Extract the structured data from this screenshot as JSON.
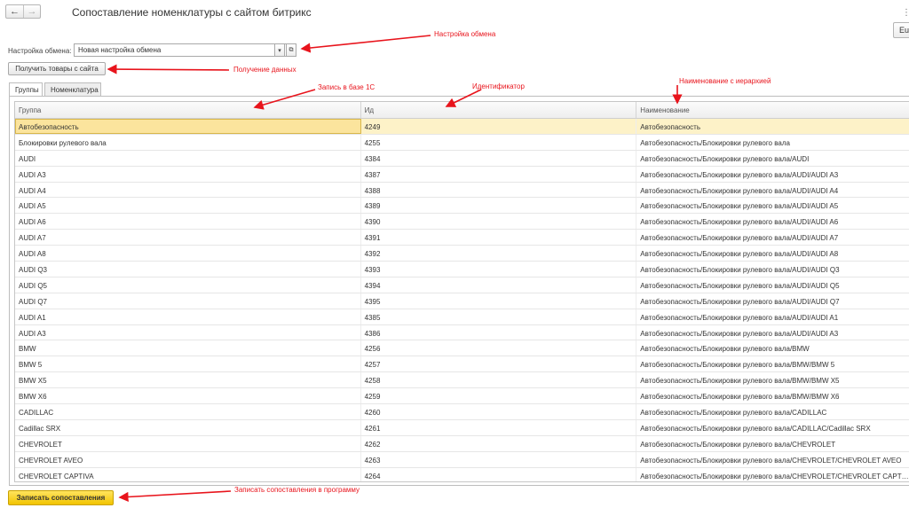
{
  "titlebar": {
    "back_icon": "arrow-left-icon",
    "forward_icon": "arrow-right-icon",
    "title": "Сопоставление номенклатуры с сайтом битрикс",
    "corner_button": "Eu",
    "more_icon": "vertical-dots-icon"
  },
  "settings": {
    "label": "Настройка обмена:",
    "value": "Новая настройка обмена",
    "dropdown_icon": "dropdown-arrow-icon",
    "open_icon": "open-form-icon"
  },
  "fetch_button": "Получить товары с сайта",
  "tabs": [
    {
      "label": "Группы",
      "active": true
    },
    {
      "label": "Номенклатура",
      "active": false
    }
  ],
  "table": {
    "columns": [
      "Группа",
      "Ид",
      "Наименование"
    ],
    "rows": [
      [
        "Автобезопасность",
        "4249",
        "Автобезопасность"
      ],
      [
        "Блокировки рулевого вала",
        "4255",
        "Автобезопасность/Блокировки рулевого вала"
      ],
      [
        "AUDI",
        "4384",
        "Автобезопасность/Блокировки рулевого вала/AUDI"
      ],
      [
        "AUDI A3",
        "4387",
        "Автобезопасность/Блокировки рулевого вала/AUDI/AUDI A3"
      ],
      [
        "AUDI A4",
        "4388",
        "Автобезопасность/Блокировки рулевого вала/AUDI/AUDI A4"
      ],
      [
        "AUDI A5",
        "4389",
        "Автобезопасность/Блокировки рулевого вала/AUDI/AUDI A5"
      ],
      [
        "AUDI A6",
        "4390",
        "Автобезопасность/Блокировки рулевого вала/AUDI/AUDI A6"
      ],
      [
        "AUDI A7",
        "4391",
        "Автобезопасность/Блокировки рулевого вала/AUDI/AUDI A7"
      ],
      [
        "AUDI A8",
        "4392",
        "Автобезопасность/Блокировки рулевого вала/AUDI/AUDI A8"
      ],
      [
        "AUDI Q3",
        "4393",
        "Автобезопасность/Блокировки рулевого вала/AUDI/AUDI Q3"
      ],
      [
        "AUDI Q5",
        "4394",
        "Автобезопасность/Блокировки рулевого вала/AUDI/AUDI Q5"
      ],
      [
        "AUDI Q7",
        "4395",
        "Автобезопасность/Блокировки рулевого вала/AUDI/AUDI Q7"
      ],
      [
        "AUDI A1",
        "4385",
        "Автобезопасность/Блокировки рулевого вала/AUDI/AUDI A1"
      ],
      [
        "AUDI A3",
        "4386",
        "Автобезопасность/Блокировки рулевого вала/AUDI/AUDI A3"
      ],
      [
        "BMW",
        "4256",
        "Автобезопасность/Блокировки рулевого вала/BMW"
      ],
      [
        "BMW 5",
        "4257",
        "Автобезопасность/Блокировки рулевого вала/BMW/BMW 5"
      ],
      [
        "BMW X5",
        "4258",
        "Автобезопасность/Блокировки рулевого вала/BMW/BMW X5"
      ],
      [
        "BMW X6",
        "4259",
        "Автобезопасность/Блокировки рулевого вала/BMW/BMW X6"
      ],
      [
        "CADILLAC",
        "4260",
        "Автобезопасность/Блокировки рулевого вала/CADILLAC"
      ],
      [
        "Cadillac SRX",
        "4261",
        "Автобезопасность/Блокировки рулевого вала/CADILLAC/Cadillac SRX"
      ],
      [
        "CHEVROLET",
        "4262",
        "Автобезопасность/Блокировки рулевого вала/CHEVROLET"
      ],
      [
        "CHEVROLET AVEO",
        "4263",
        "Автобезопасность/Блокировки рулевого вала/CHEVROLET/CHEVROLET AVEO"
      ],
      [
        "CHEVROLET CAPTIVA",
        "4264",
        "Автобезопасность/Блокировки рулевого вала/CHEVROLET/CHEVROLET CAPT…"
      ]
    ]
  },
  "save_button": "Записать сопоставления",
  "annotations": {
    "settings": "Настройка обмена",
    "fetch": "Получение данных",
    "group": "Запись в базе 1С",
    "id": "Идентификатор",
    "name": "Наименование с иерархией",
    "save": "Записать сопоставления в программу"
  },
  "colors": {
    "selected_row": "#fdf2c8",
    "selected_cell": "#fbe49d",
    "primary_button": "#f5cc12",
    "annotation": "#e8141c"
  }
}
